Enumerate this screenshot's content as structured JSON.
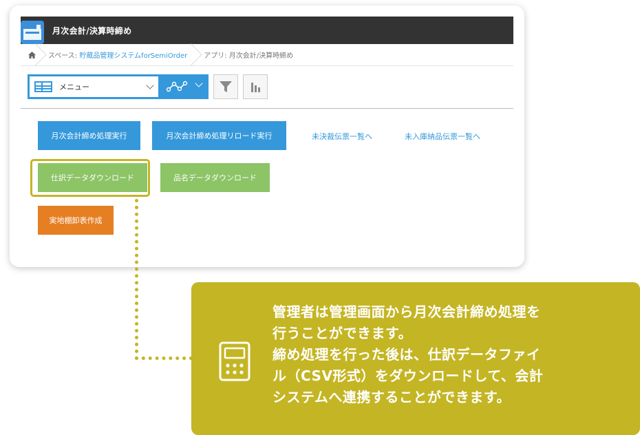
{
  "app": {
    "title": "月次会計/決算時締め"
  },
  "breadcrumb": {
    "space_prefix": "スペース: ",
    "space_name": "貯蔵品管理システムforSemiOrder",
    "app_label": "アプリ: 月次会計/決算時締め"
  },
  "toolbar": {
    "view_label": "メニュー"
  },
  "buttons": {
    "monthly_close": "月次会計締め処理実行",
    "monthly_close_reload": "月次会計締め処理リロード実行",
    "unsettled_link": "未決裁伝票一覧へ",
    "not_received_link": "未入庫納品伝票一覧へ",
    "journal_download": "仕訳データダウンロード",
    "item_download": "品名データダウンロード",
    "inventory_create": "実地棚卸表作成"
  },
  "callout": {
    "lines": [
      "管理者は管理画面から月次会計締め処理を",
      "行うことができます。",
      "締め処理を行った後は、仕訳データファイ",
      "ル（CSV形式）をダウンロードして、会計",
      "システムへ連携することができます。"
    ]
  },
  "colors": {
    "accent": "#3498db",
    "green": "#8cc466",
    "orange": "#e67e22",
    "callout": "#c4b524",
    "titlebar": "#333333"
  }
}
